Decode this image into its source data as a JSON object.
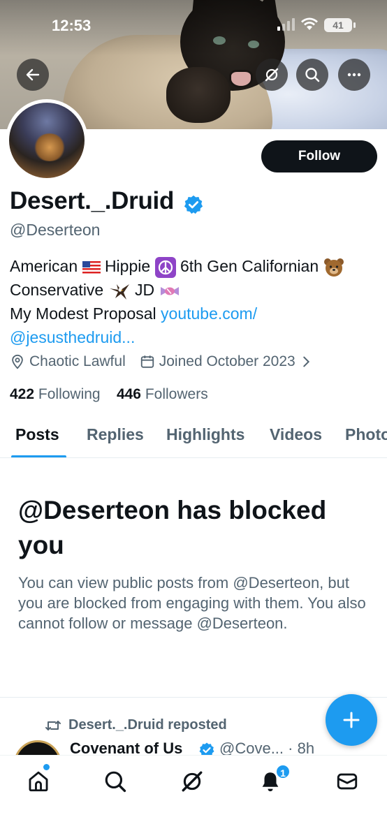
{
  "status_bar": {
    "time": "12:53",
    "battery": "41"
  },
  "profile": {
    "display_name": "Desert._.Druid",
    "handle": "@Deserteon",
    "follow_label": "Follow",
    "bio": {
      "line1_a": "American",
      "line1_b": "Hippie",
      "line1_c": "6th Gen Californian",
      "line2_a": "Conservative",
      "line2_b": "JD",
      "line3_text": "My Modest Proposal ",
      "line3_link": "youtube.com/",
      "line4_link": "@jesusthedruid..."
    },
    "location": "Chaotic Lawful",
    "joined": "Joined October 2023",
    "following_count": "422",
    "following_label": "Following",
    "followers_count": "446",
    "followers_label": "Followers"
  },
  "tabs": [
    {
      "label": "Posts"
    },
    {
      "label": "Replies"
    },
    {
      "label": "Highlights"
    },
    {
      "label": "Videos"
    },
    {
      "label": "Photos"
    }
  ],
  "blocked": {
    "title": "@Deserteon has blocked you",
    "body": "You can view public posts from @Deserteon, but you are blocked from engaging with them. You also cannot follow or message @Deserteon."
  },
  "post": {
    "repost_label": "Desert._.Druid reposted",
    "author": "Covenant of Us",
    "handle_time": "@Cove... · 8h"
  },
  "bottom_nav": {
    "notif_badge": "1"
  },
  "colors": {
    "accent": "#1d9bf0",
    "text": "#0f1419",
    "muted": "#536471"
  }
}
